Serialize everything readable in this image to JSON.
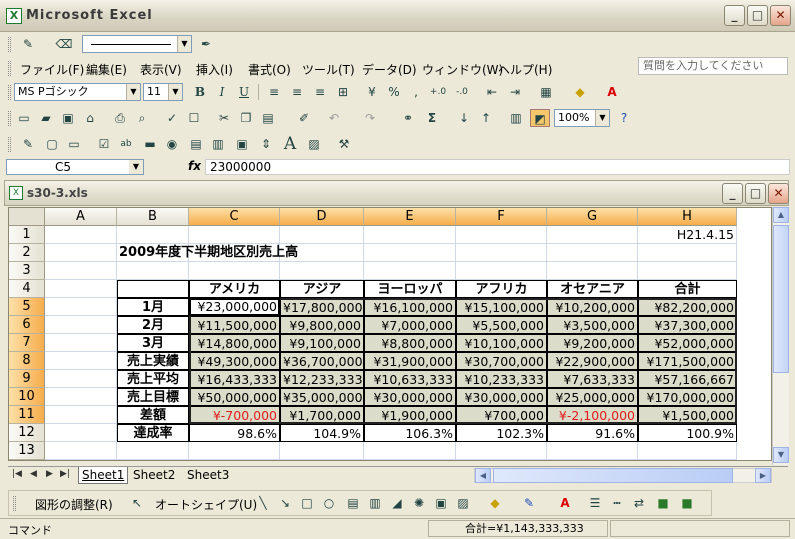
{
  "app": {
    "title": "Microsoft Excel",
    "logo_letter": "X",
    "win_min": "_",
    "win_max": "□",
    "win_close": "✕"
  },
  "menubar": {
    "items": [
      "ファイル(F)",
      "編集(E)",
      "表示(V)",
      "挿入(I)",
      "書式(O)",
      "ツール(T)",
      "データ(D)",
      "ウィンドウ(W)",
      "ヘルプ(H)"
    ],
    "help_placeholder": "質問を入力してください"
  },
  "format_toolbar": {
    "font": "MS Pゴシック",
    "size": "11",
    "bold": "B",
    "italic": "I",
    "underline": "U",
    "percent": "%",
    "comma": ","
  },
  "std_toolbar": {
    "zoom": "100%",
    "sigma": "Σ"
  },
  "forms_toolbar": {
    "big_a": "A"
  },
  "formula_bar": {
    "name_box": "C5",
    "fx": "fx",
    "value": "23000000"
  },
  "workbook": {
    "title": "s30-3.xls",
    "logo_letter": "X"
  },
  "columns": [
    "A",
    "B",
    "C",
    "D",
    "E",
    "F",
    "G",
    "H"
  ],
  "rows": [
    "1",
    "2",
    "3",
    "4",
    "5",
    "6",
    "7",
    "8",
    "9",
    "10",
    "11",
    "12",
    "13"
  ],
  "cells": {
    "H1": "H21.4.15",
    "B2": "2009年度下半期地区別売上高",
    "headers": [
      "アメリカ",
      "アジア",
      "ヨーロッパ",
      "アフリカ",
      "オセアニア",
      "合計"
    ],
    "labels": [
      "1月",
      "2月",
      "3月",
      "売上実績",
      "売上平均",
      "売上目標",
      "差額",
      "達成率"
    ],
    "data": [
      [
        "¥23,000,000",
        "¥17,800,000",
        "¥16,100,000",
        "¥15,100,000",
        "¥10,200,000",
        "¥82,200,000"
      ],
      [
        "¥11,500,000",
        "¥9,800,000",
        "¥7,000,000",
        "¥5,500,000",
        "¥3,500,000",
        "¥37,300,000"
      ],
      [
        "¥14,800,000",
        "¥9,100,000",
        "¥8,800,000",
        "¥10,100,000",
        "¥9,200,000",
        "¥52,000,000"
      ],
      [
        "¥49,300,000",
        "¥36,700,000",
        "¥31,900,000",
        "¥30,700,000",
        "¥22,900,000",
        "¥171,500,000"
      ],
      [
        "¥16,433,333",
        "¥12,233,333",
        "¥10,633,333",
        "¥10,233,333",
        "¥7,633,333",
        "¥57,166,667"
      ],
      [
        "¥50,000,000",
        "¥35,000,000",
        "¥30,000,000",
        "¥30,000,000",
        "¥25,000,000",
        "¥170,000,000"
      ],
      [
        "¥-700,000",
        "¥1,700,000",
        "¥1,900,000",
        "¥700,000",
        "¥-2,100,000",
        "¥1,500,000"
      ],
      [
        "98.6%",
        "104.9%",
        "106.3%",
        "102.3%",
        "91.6%",
        "100.9%"
      ]
    ]
  },
  "sheet_tabs": [
    "Sheet1",
    "Sheet2",
    "Sheet3"
  ],
  "sheet_nav": [
    "|◀",
    "◀",
    "▶",
    "▶|"
  ],
  "drawing_toolbar": {
    "draw_menu": "図形の調整(R)",
    "autoshape_menu": "オートシェイプ(U)"
  },
  "status": {
    "mode": "コマンド",
    "sum": "合計=¥1,143,333,333"
  },
  "colors": {
    "negative": "#e31b1b",
    "selected_header": "#f6ad4c",
    "shaded_cell": "#dcdcca"
  }
}
